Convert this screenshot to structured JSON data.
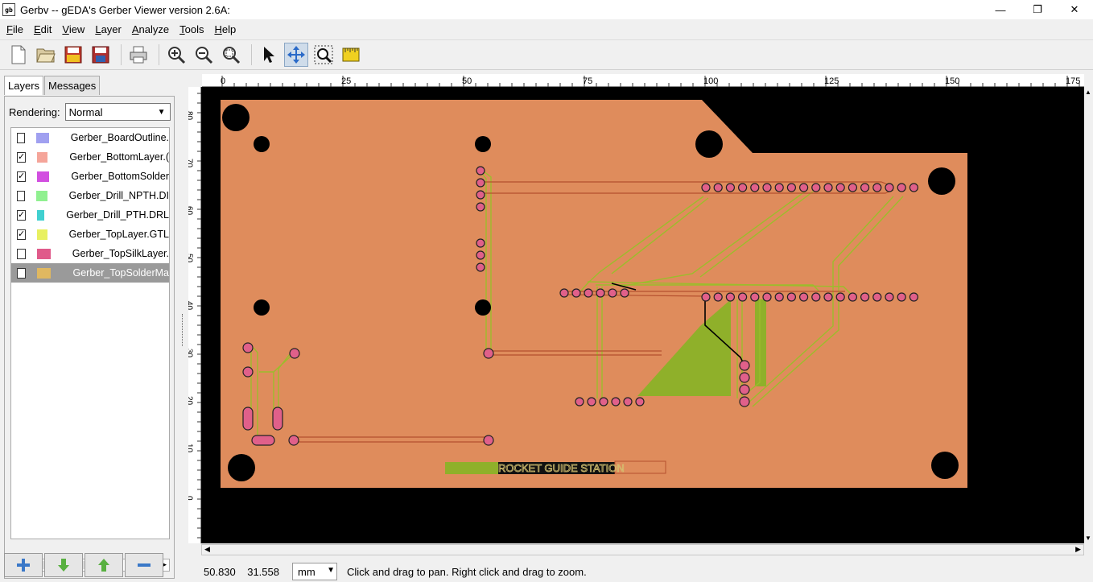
{
  "window": {
    "title": "Gerbv -- gEDA's Gerber Viewer version 2.6A:",
    "controls": [
      "—",
      "❐",
      "✕"
    ]
  },
  "menubar": [
    {
      "first": "F",
      "rest": "ile"
    },
    {
      "first": "E",
      "rest": "dit"
    },
    {
      "first": "V",
      "rest": "iew"
    },
    {
      "first": "L",
      "rest": "ayer"
    },
    {
      "first": "A",
      "rest": "nalyze"
    },
    {
      "first": "T",
      "rest": "ools"
    },
    {
      "first": "H",
      "rest": "elp"
    }
  ],
  "toolbar": {
    "icons": [
      "new-icon",
      "open-icon",
      "revert-icon",
      "save-icon",
      "print-icon",
      "zoom-in-icon",
      "zoom-out-icon",
      "zoom-fit-icon",
      "pointer-tool-icon",
      "pan-tool-icon",
      "zoom-tool-icon",
      "measure-tool-icon"
    ],
    "active_tool": "pan-tool-icon"
  },
  "sidebar": {
    "tabs": [
      "Layers",
      "Messages"
    ],
    "rendering_label": "Rendering:",
    "rendering_value": "Normal",
    "layers": [
      {
        "name": "Gerber_BoardOutline.",
        "checked": false,
        "color": "#a0a0f0",
        "selected": false
      },
      {
        "name": "Gerber_BottomLayer.(",
        "checked": true,
        "color": "#f5a59a",
        "selected": false
      },
      {
        "name": "Gerber_BottomSolder",
        "checked": true,
        "color": "#d24fe0",
        "selected": false
      },
      {
        "name": "Gerber_Drill_NPTH.DI",
        "checked": false,
        "color": "#90f090",
        "selected": false
      },
      {
        "name": "Gerber_Drill_PTH.DRL",
        "checked": true,
        "color": "#40d0d0",
        "selected": false
      },
      {
        "name": "Gerber_TopLayer.GTL",
        "checked": true,
        "color": "#e8f060",
        "selected": false
      },
      {
        "name": "Gerber_TopSilkLayer.",
        "checked": false,
        "color": "#e05a8a",
        "selected": false
      },
      {
        "name": "Gerber_TopSolderMa",
        "checked": false,
        "color": "#e0b860",
        "selected": true
      }
    ],
    "layer_buttons": [
      "add-layer-icon",
      "move-down-icon",
      "move-up-icon",
      "remove-layer-icon"
    ]
  },
  "rulers": {
    "x_ticks": [
      "0",
      "25",
      "50",
      "75",
      "100",
      "125",
      "150",
      "175"
    ],
    "y_ticks": [
      "80",
      "70",
      "60",
      "50",
      "40",
      "30",
      "20",
      "10",
      "0"
    ]
  },
  "pcb": {
    "board_color": "#df8c5c",
    "trace_color": "#9cbc2c",
    "pad_color": "#e0608a",
    "silk_text": "ROCKET GUIDE STATION"
  },
  "status": {
    "x": "50.830",
    "y": "31.558",
    "unit": "mm",
    "message": "Click and drag to pan. Right click and drag to zoom."
  }
}
